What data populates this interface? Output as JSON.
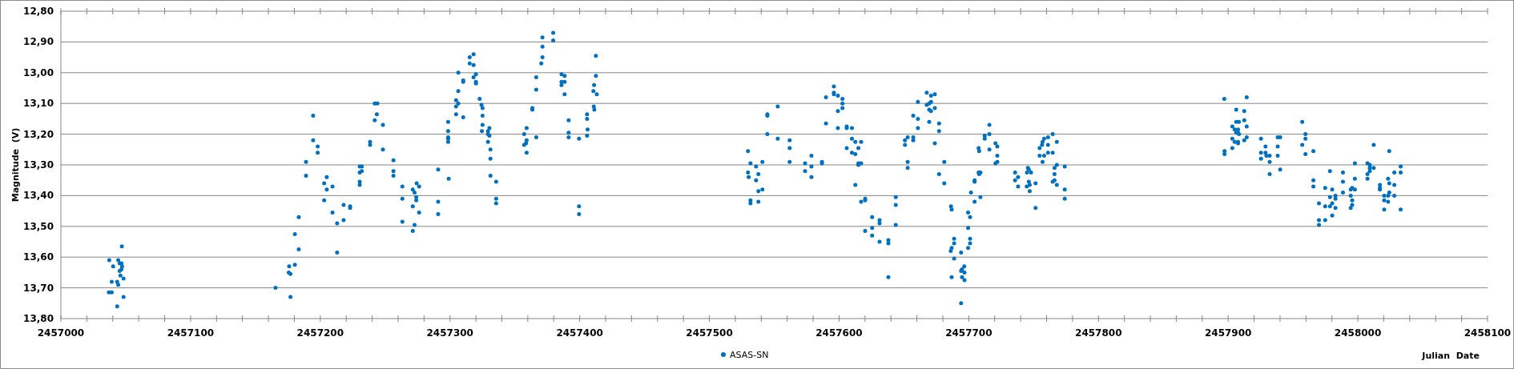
{
  "chart_data": {
    "type": "scatter",
    "grid": true,
    "ylabel": "Magnitude  (V)",
    "xlabel": "Julian  Date",
    "xlim": [
      2457000,
      2458100
    ],
    "ylim": [
      13.8,
      12.8
    ],
    "xticks": [
      2457000,
      2457100,
      2457200,
      2457300,
      2457400,
      2457500,
      2457600,
      2457700,
      2457800,
      2457900,
      2458000,
      2458100
    ],
    "yticks": [
      {
        "value": 12.8,
        "label": "12,80"
      },
      {
        "value": 12.9,
        "label": "12,90"
      },
      {
        "value": 13.0,
        "label": "13,00"
      },
      {
        "value": 13.1,
        "label": "13,10"
      },
      {
        "value": 13.2,
        "label": "13,20"
      },
      {
        "value": 13.3,
        "label": "13,30"
      },
      {
        "value": 13.4,
        "label": "13,40"
      },
      {
        "value": 13.5,
        "label": "13,50"
      },
      {
        "value": 13.6,
        "label": "13,60"
      },
      {
        "value": 13.7,
        "label": "13,70"
      },
      {
        "value": 13.8,
        "label": "13,80"
      }
    ],
    "x": [
      2457037.3,
      2457037,
      2457039.2,
      2457040.3,
      2457039.2,
      2457043.4,
      2457043.4,
      2457044.2,
      2457044.2,
      2457045.3,
      2457045.3,
      2457045.9,
      2457046.7,
      2457047,
      2457047.2,
      2457046.7,
      2457048.3,
      2457048.3,
      2457165.5,
      2457176,
      2457175.7,
      2457177,
      2457177,
      2457180.4,
      2457180.4,
      2457183.4,
      2457183.4,
      2457189,
      2457189,
      2457194.5,
      2457194.5,
      2457198,
      2457198,
      2457203,
      2457203,
      2457205,
      2457205,
      2457209.4,
      2457209.4,
      2457213,
      2457213,
      2457218,
      2457218,
      2457223,
      2457223,
      2457230.4,
      2457230.4,
      2457230.4,
      2457230.4,
      2457232,
      2457232,
      2457238.4,
      2457238.4,
      2457242,
      2457244,
      2457243.6,
      2457242,
      2457248.3,
      2457248.3,
      2457256.4,
      2457256.4,
      2457256.4,
      2457263.3,
      2457263.3,
      2457263.3,
      2457271.3,
      2457271.3,
      2457271.3,
      2457272.7,
      2457272.7,
      2457274,
      2457274,
      2457274.3,
      2457276.2,
      2457276.2,
      2457290.9,
      2457290.9,
      2457290.9,
      2457298.6,
      2457298.6,
      2457298.6,
      2457298.6,
      2457298.6,
      2457299,
      2457304.7,
      2457304.7,
      2457304.7,
      2457306.4,
      2457306.4,
      2457306.4,
      2457310.2,
      2457310.2,
      2457310.2,
      2457315.2,
      2457315.2,
      2457318.2,
      2457318.2,
      2457318.2,
      2457320,
      2457320,
      2457320,
      2457322.9,
      2457324.3,
      2457325.1,
      2457325.1,
      2457325.1,
      2457324.6,
      2457329.3,
      2457329.3,
      2457329.3,
      2457330.4,
      2457330.4,
      2457331.2,
      2457331.2,
      2457331.2,
      2457335.6,
      2457335.6,
      2457335.6,
      2457357.2,
      2457357.2,
      2457358.6,
      2457359.1,
      2457359.1,
      2457359.1,
      2457363.5,
      2457363.5,
      2457366.5,
      2457366.5,
      2457366.5,
      2457370.4,
      2457371.3,
      2457371.3,
      2457371.3,
      2457379.6,
      2457379.6,
      2457386,
      2457386,
      2457386,
      2457388.4,
      2457388.4,
      2457388.4,
      2457391.5,
      2457391.5,
      2457391.5,
      2457399.5,
      2457399.5,
      2457399.5,
      2457405.7,
      2457405.7,
      2457406.1,
      2457405.7,
      2457410.6,
      2457411.1,
      2457412.5,
      2457412.5,
      2457413.2,
      2457410.9,
      2457411.3,
      2457529.8,
      2457529.8,
      2457530.3,
      2457531.7,
      2457531.7,
      2457531.7,
      2457536,
      2457536,
      2457537.8,
      2457537.8,
      2457537.8,
      2457540.9,
      2457540.9,
      2457544.7,
      2457544.7,
      2457544.7,
      2457552.7,
      2457552.7,
      2457561.9,
      2457561.9,
      2457561.9,
      2457573.8,
      2457573.8,
      2457578.7,
      2457578.7,
      2457578.7,
      2457586.8,
      2457586.8,
      2457589.9,
      2457589.9,
      2457596,
      2457596,
      2457596,
      2457599.1,
      2457599.1,
      2457599.1,
      2457602.6,
      2457602.6,
      2457602.6,
      2457605.9,
      2457605.9,
      2457605.9,
      2457609.9,
      2457609.9,
      2457609.9,
      2457612.5,
      2457612.5,
      2457612.5,
      2457614.9,
      2457614.9,
      2457614.9,
      2457617,
      2457617,
      2457617,
      2457620.1,
      2457620.1,
      2457620.1,
      2457625.5,
      2457625.5,
      2457625.5,
      2457631.2,
      2457631.2,
      2457631.2,
      2457638,
      2457638,
      2457638,
      2457643.7,
      2457643.7,
      2457643.7,
      2457650.8,
      2457650.8,
      2457652.9,
      2457652.9,
      2457652.9,
      2457657.2,
      2457657.2,
      2457657.2,
      2457660.8,
      2457660.8,
      2457660.8,
      2457667.6,
      2457667.6,
      2457669.5,
      2457669.5,
      2457669.5,
      2457670.9,
      2457670.9,
      2457670.9,
      2457673.8,
      2457673.8,
      2457673.8,
      2457677.1,
      2457677.1,
      2457677.1,
      2457681.1,
      2457681.1,
      2457686.3,
      2457686.8,
      2457686.8,
      2457686.1,
      2457686.8,
      2457688.7,
      2457688.7,
      2457688.7,
      2457694.1,
      2457694.1,
      2457694.1,
      2457694.8,
      2457694.8,
      2457696.5,
      2457696.7,
      2457696.7,
      2457699.5,
      2457699.5,
      2457699.5,
      2457701,
      2457701,
      2457701,
      2457701.7,
      2457704.5,
      2457704.5,
      2457704.5,
      2457707.6,
      2457708,
      2457708,
      2457707.6,
      2457709,
      2457709,
      2457712.3,
      2457712.3,
      2457715.9,
      2457715.9,
      2457715.9,
      2457720.6,
      2457722,
      2457722,
      2457722,
      2457720.6,
      2457735.7,
      2457735.7,
      2457738,
      2457738,
      2457744.9,
      2457745.6,
      2457746.3,
      2457748,
      2457746.3,
      2457747,
      2457744.7,
      2457747,
      2457751.5,
      2457751.5,
      2457754.6,
      2457754.6,
      2457756.5,
      2457756.9,
      2457758.1,
      2457761.1,
      2457761.1,
      2457764.7,
      2457767.9,
      2457756.9,
      2457758.1,
      2457761.1,
      2457764.7,
      2457766.1,
      2457766.1,
      2457766.1,
      2457764.7,
      2457767.9,
      2457767.9,
      2457774,
      2457774,
      2457774,
      2457897,
      2457897.2,
      2457897.2,
      2457903.2,
      2457903.2,
      2457903.2,
      2457905,
      2457905,
      2457906.2,
      2457906.2,
      2457906.2,
      2457907.6,
      2457907.6,
      2457907.6,
      2457907.6,
      2457908.3,
      2457908.3,
      2457912.4,
      2457912.4,
      2457912.4,
      2457914.3,
      2457914.3,
      2457914.3,
      2457925.3,
      2457925.3,
      2457925.3,
      2457928.8,
      2457928.8,
      2457929.5,
      2457932,
      2457932,
      2457932,
      2457938.2,
      2457938.2,
      2457938.2,
      2457940.1,
      2457940.1,
      2457957.1,
      2457957.1,
      2457959.6,
      2457959.6,
      2457959.6,
      2457965.7,
      2457965.7,
      2457965.7,
      2457970,
      2457970,
      2457970,
      2457974.8,
      2457974.8,
      2457974.8,
      2457978.5,
      2457978.5,
      2457978.5,
      2457980.2,
      2457980.2,
      2457980.2,
      2457982.7,
      2457982.7,
      2457982.7,
      2457988.5,
      2457988.5,
      2457988.5,
      2457994.5,
      2457994.5,
      2457994.5,
      2457995.6,
      2457995.6,
      2457995.6,
      2457997.7,
      2457997.7,
      2457997.7,
      2458007.4,
      2458007.4,
      2458007.4,
      2458009.2,
      2458009.2,
      2458009.2,
      2458012.2,
      2458012.2,
      2458017,
      2458017,
      2458017,
      2458020.3,
      2458020.3,
      2458020.3,
      2458023.3,
      2458023.3,
      2458023.3,
      2458024.2,
      2458024.2,
      2458024.2,
      2458028.1,
      2458028.1,
      2458028.1,
      2458033,
      2458033,
      2458033
    ],
    "series": [
      {
        "name": "ASAS-SN",
        "color": "#0070c0",
        "values": [
          13.61,
          13.715,
          13.68,
          13.63,
          13.715,
          13.76,
          13.68,
          13.61,
          13.69,
          13.62,
          13.645,
          13.66,
          13.62,
          13.565,
          13.63,
          13.64,
          13.67,
          13.73,
          13.7,
          13.63,
          13.65,
          13.655,
          13.73,
          13.625,
          13.525,
          13.47,
          13.575,
          13.29,
          13.335,
          13.14,
          13.22,
          13.24,
          13.26,
          13.36,
          13.415,
          13.34,
          13.38,
          13.37,
          13.455,
          13.49,
          13.585,
          13.43,
          13.48,
          13.435,
          13.44,
          13.305,
          13.325,
          13.355,
          13.365,
          13.305,
          13.32,
          13.225,
          13.235,
          13.1,
          13.1,
          13.135,
          13.155,
          13.17,
          13.25,
          13.285,
          13.32,
          13.335,
          13.37,
          13.41,
          13.485,
          13.38,
          13.435,
          13.515,
          13.39,
          13.495,
          13.405,
          13.415,
          13.36,
          13.37,
          13.455,
          13.315,
          13.42,
          13.46,
          13.16,
          13.19,
          13.21,
          13.215,
          13.225,
          13.345,
          13.11,
          13.09,
          13.135,
          13.0,
          13.06,
          13.1,
          13.025,
          13.03,
          13.145,
          12.95,
          12.97,
          12.94,
          12.975,
          13.015,
          13.005,
          13.03,
          13.035,
          13.085,
          13.105,
          13.115,
          13.14,
          13.17,
          13.19,
          13.19,
          13.2,
          13.225,
          13.18,
          13.205,
          13.25,
          13.28,
          13.335,
          13.355,
          13.41,
          13.425,
          13.2,
          13.235,
          13.23,
          13.18,
          13.22,
          13.26,
          13.115,
          13.12,
          13.015,
          13.055,
          13.21,
          12.97,
          12.95,
          12.915,
          12.885,
          12.87,
          12.895,
          13.005,
          13.03,
          13.04,
          13.01,
          13.03,
          13.07,
          13.155,
          13.195,
          13.21,
          13.215,
          13.435,
          13.46,
          13.135,
          13.15,
          13.185,
          13.205,
          13.06,
          13.04,
          13.01,
          12.945,
          13.07,
          13.11,
          13.12,
          13.255,
          13.325,
          13.34,
          13.295,
          13.415,
          13.425,
          13.305,
          13.35,
          13.33,
          13.385,
          13.42,
          13.29,
          13.38,
          13.14,
          13.135,
          13.2,
          13.11,
          13.215,
          13.22,
          13.245,
          13.29,
          13.295,
          13.32,
          13.27,
          13.305,
          13.34,
          13.29,
          13.295,
          13.08,
          13.165,
          13.045,
          13.065,
          13.07,
          13.075,
          13.125,
          13.18,
          13.085,
          13.1,
          13.115,
          13.175,
          13.18,
          13.245,
          13.18,
          13.215,
          13.26,
          13.225,
          13.265,
          13.365,
          13.245,
          13.295,
          13.3,
          13.225,
          13.295,
          13.42,
          13.41,
          13.415,
          13.515,
          13.47,
          13.505,
          13.53,
          13.48,
          13.49,
          13.55,
          13.545,
          13.555,
          13.665,
          13.405,
          13.43,
          13.495,
          13.22,
          13.235,
          13.21,
          13.29,
          13.31,
          13.14,
          13.21,
          13.22,
          13.095,
          13.15,
          13.18,
          13.065,
          13.105,
          13.1,
          13.12,
          13.16,
          13.075,
          13.095,
          13.125,
          13.07,
          13.115,
          13.23,
          13.165,
          13.19,
          13.33,
          13.29,
          13.36,
          13.435,
          13.445,
          13.665,
          13.58,
          13.57,
          13.54,
          13.555,
          13.605,
          13.585,
          13.645,
          13.75,
          13.64,
          13.665,
          13.63,
          13.65,
          13.675,
          13.455,
          13.505,
          13.57,
          13.47,
          13.54,
          13.555,
          13.39,
          13.35,
          13.355,
          13.42,
          13.245,
          13.255,
          13.33,
          13.325,
          13.325,
          13.405,
          13.205,
          13.215,
          13.17,
          13.2,
          13.25,
          13.23,
          13.24,
          13.27,
          13.29,
          13.295,
          13.325,
          13.35,
          13.34,
          13.37,
          13.325,
          13.31,
          13.315,
          13.325,
          13.355,
          13.365,
          13.37,
          13.385,
          13.36,
          13.44,
          13.245,
          13.27,
          13.235,
          13.225,
          13.215,
          13.21,
          13.235,
          13.2,
          13.225,
          13.29,
          13.27,
          13.26,
          13.26,
          13.31,
          13.33,
          13.35,
          13.355,
          13.3,
          13.365,
          13.305,
          13.38,
          13.41,
          13.085,
          13.255,
          13.265,
          13.175,
          13.215,
          13.245,
          13.185,
          13.225,
          13.12,
          13.16,
          13.195,
          13.185,
          13.195,
          13.225,
          13.23,
          13.16,
          13.2,
          13.125,
          13.155,
          13.22,
          13.175,
          13.08,
          13.21,
          13.215,
          13.26,
          13.28,
          13.24,
          13.26,
          13.27,
          13.27,
          13.29,
          13.33,
          13.21,
          13.24,
          13.27,
          13.21,
          13.315,
          13.16,
          13.235,
          13.2,
          13.215,
          13.265,
          13.255,
          13.35,
          13.37,
          13.425,
          13.48,
          13.495,
          13.375,
          13.435,
          13.48,
          13.32,
          13.405,
          13.435,
          13.38,
          13.425,
          13.465,
          13.4,
          13.41,
          13.44,
          13.325,
          13.355,
          13.39,
          13.38,
          13.4,
          13.44,
          13.375,
          13.415,
          13.43,
          13.295,
          13.345,
          13.38,
          13.295,
          13.33,
          13.345,
          13.3,
          13.31,
          13.32,
          13.235,
          13.31,
          13.365,
          13.375,
          13.38,
          13.4,
          13.415,
          13.445,
          13.345,
          13.4,
          13.42,
          13.255,
          13.36,
          13.39,
          13.325,
          13.365,
          13.4,
          13.305,
          13.325,
          13.445
        ]
      }
    ]
  }
}
